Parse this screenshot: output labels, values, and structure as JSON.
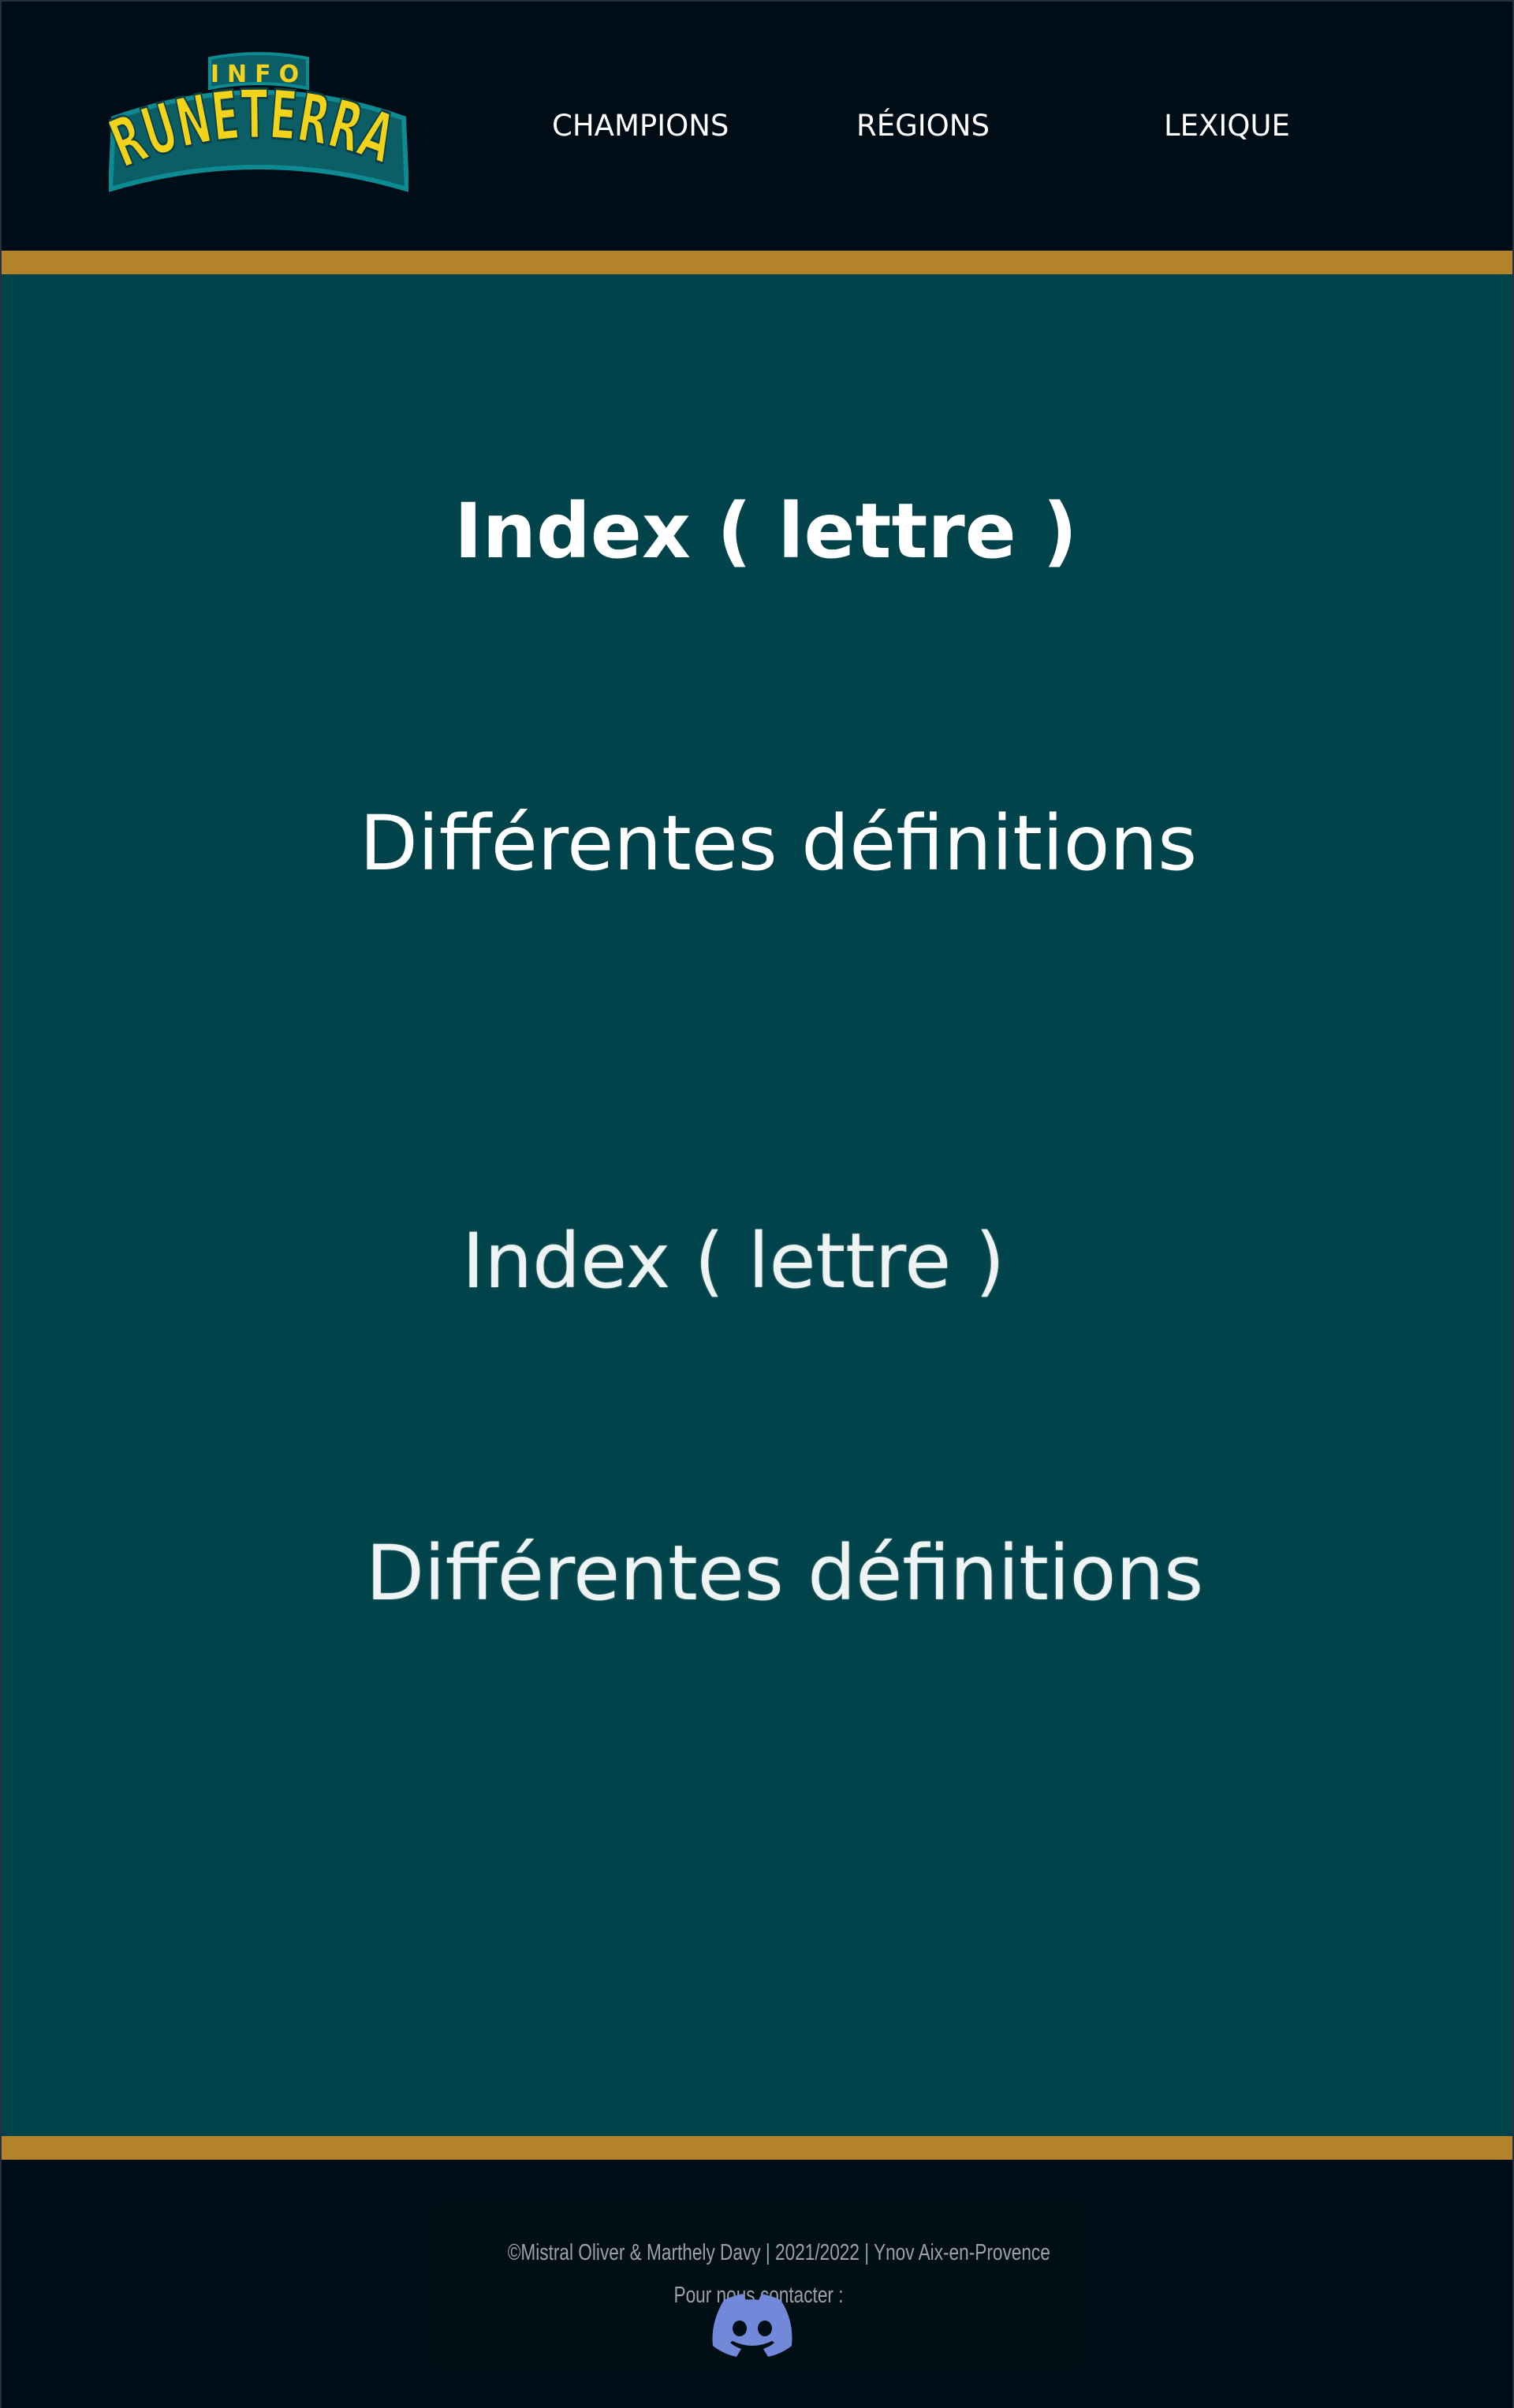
{
  "brand": {
    "logo_top_text": "INFO",
    "logo_main_text": "RUNETERRA",
    "logo_fill_color": "#f2d31b",
    "logo_outline_color": "#0b6f78"
  },
  "nav": {
    "items": [
      {
        "label": "CHAMPIONS"
      },
      {
        "label": "RÉGIONS"
      },
      {
        "label": "LEXIQUE"
      }
    ]
  },
  "main": {
    "entries": [
      {
        "index": "Index ( lettre )",
        "definition": "Différentes définitions"
      },
      {
        "index": "Index ( lettre )",
        "definition": "Différentes définitions"
      }
    ]
  },
  "footer": {
    "copyright": "©Mistral Oliver & Marthely Davy | 2021/2022 | Ynov Aix-en-Provence",
    "contact": "Pour nous contacter :",
    "discord_icon": "discord-icon"
  },
  "colors": {
    "header_bg": "#000c16",
    "accent_gold": "#b4822a",
    "main_bg": "#00434a",
    "discord": "#7289da"
  }
}
